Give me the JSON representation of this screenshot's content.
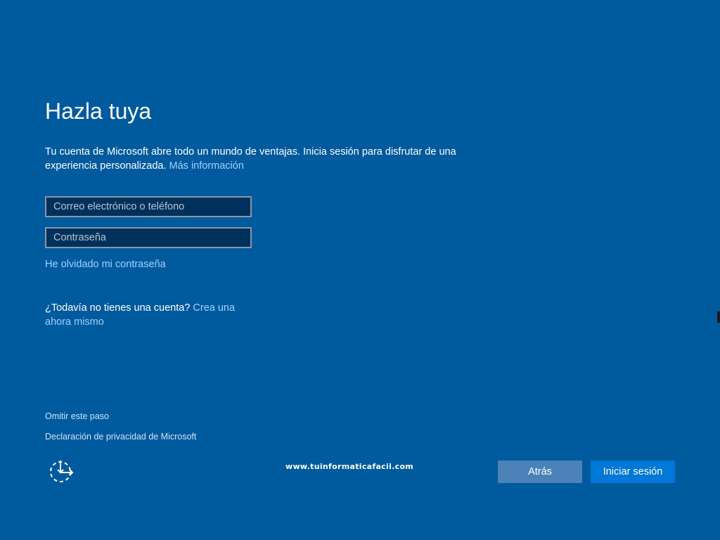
{
  "page": {
    "title": "Hazla tuya",
    "intro_text": "Tu cuenta de Microsoft abre todo un mundo de ventajas. Inicia sesión para disfrutar de una experiencia personalizada.",
    "more_info_link": "Más información"
  },
  "form": {
    "email_placeholder": "Correo electrónico o teléfono",
    "email_value": "",
    "password_placeholder": "Contraseña",
    "password_value": "",
    "forgot_password_link": "He olvidado mi contraseña"
  },
  "account": {
    "no_account_text": "¿Todavía no tienes una cuenta?",
    "create_link": "Crea una ahora mismo"
  },
  "footer": {
    "skip_link": "Omitir este paso",
    "privacy_link": "Declaración de privacidad de Microsoft",
    "watermark": "www.tuinformaticafacil.com",
    "accessibility_icon": "ease-of-access-icon"
  },
  "buttons": {
    "back_label": "Atrás",
    "signin_label": "Iniciar sesión"
  },
  "colors": {
    "background": "#005a9e",
    "link": "#9fd2ff",
    "primary_button": "#0078d7",
    "secondary_button": "#4b82b7",
    "input_background": "#00315c"
  }
}
